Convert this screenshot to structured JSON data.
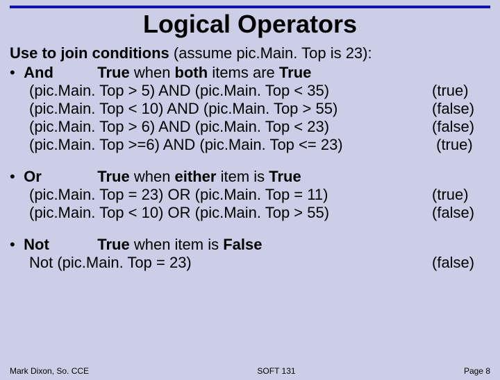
{
  "title": "Logical Operators",
  "intro": {
    "bold": "Use to join conditions",
    "rest": " (assume pic.Main. Top is 23):"
  },
  "and": {
    "name": "And",
    "desc_prefix": "True",
    "desc_mid": " when ",
    "desc_bold2": "both",
    "desc_mid2": " items are ",
    "desc_bold3": "True",
    "rows": [
      {
        "expr": "(pic.Main. Top > 5) AND (pic.Main. Top < 35)",
        "res": "(true)"
      },
      {
        "expr": "(pic.Main. Top < 10) AND (pic.Main. Top > 55)",
        "res": "(false)"
      },
      {
        "expr": "(pic.Main. Top > 6) AND (pic.Main. Top < 23)",
        "res": "(false)"
      },
      {
        "expr": "(pic.Main. Top >=6) AND (pic.Main. Top <= 23)",
        "res": " (true)"
      }
    ]
  },
  "or": {
    "name": "Or",
    "desc_prefix": "True",
    "desc_mid": " when ",
    "desc_bold2": "either",
    "desc_mid2": " item is ",
    "desc_bold3": "True",
    "rows": [
      {
        "expr": "(pic.Main. Top = 23) OR (pic.Main. Top = 11)",
        "res": "(true)"
      },
      {
        "expr": "(pic.Main. Top < 10) OR (pic.Main. Top > 55)",
        "res": "(false)"
      }
    ]
  },
  "not": {
    "name": "Not",
    "desc_prefix": "True",
    "desc_mid": " when item is ",
    "desc_bold2": "False",
    "expr": "Not (pic.Main. Top = 23)",
    "res": "(false)"
  },
  "footer": {
    "left": "Mark Dixon, So. CCE",
    "center": "SOFT 131",
    "right": "Page 8"
  }
}
